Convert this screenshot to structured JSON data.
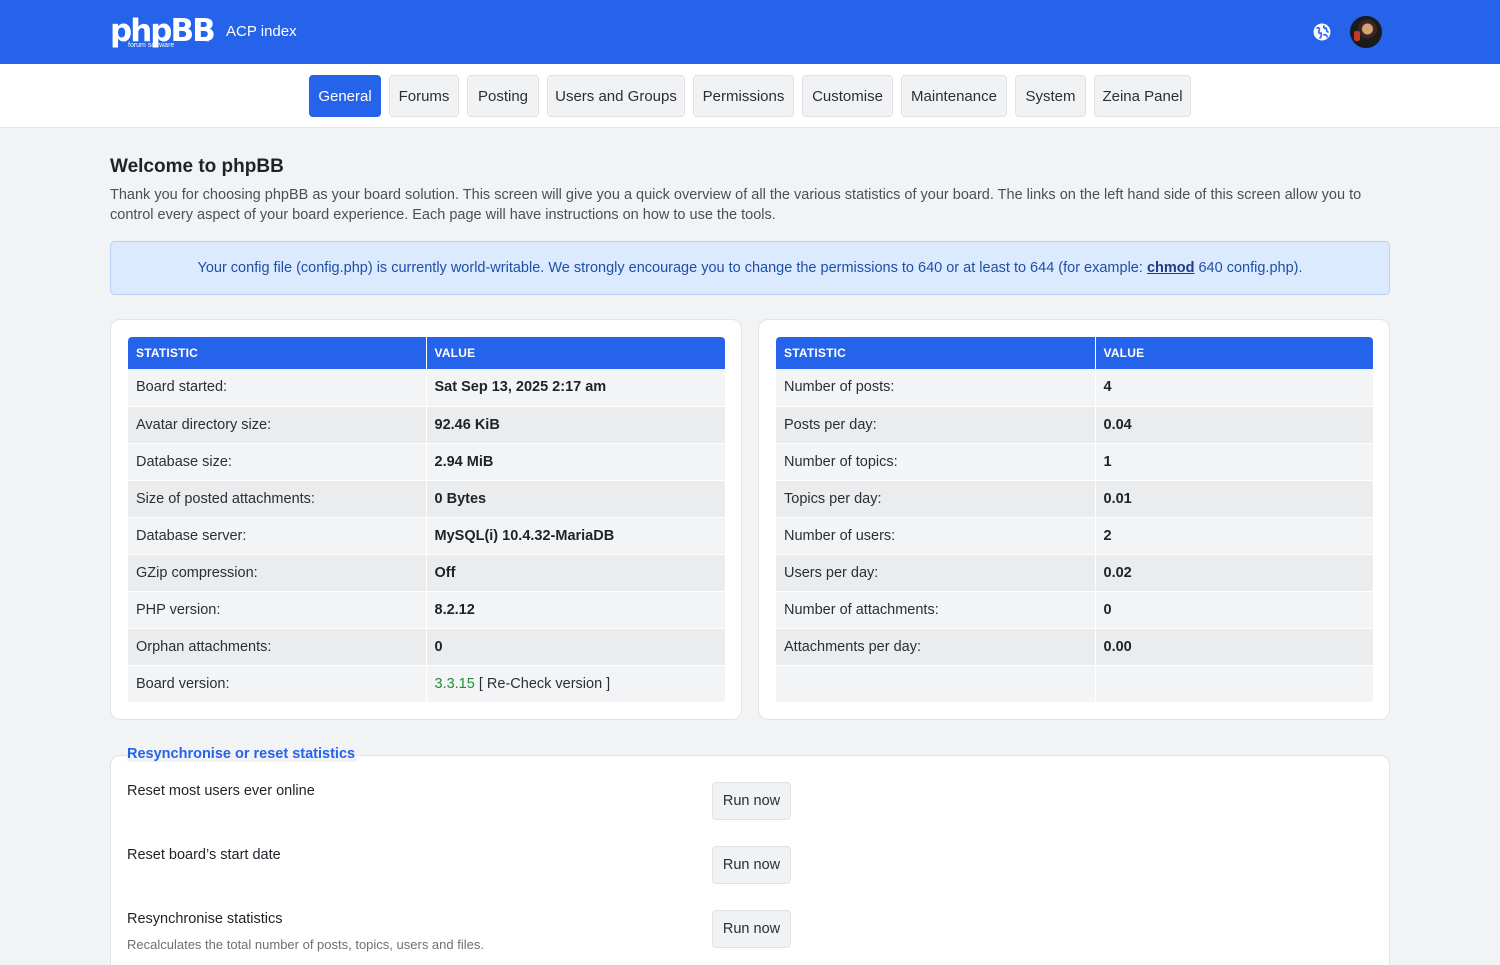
{
  "header": {
    "logo_text": "phpBB",
    "logo_sub": "forum  software",
    "logo_reg": "®",
    "title": "ACP index",
    "icons": [
      "globe-icon",
      "avatar"
    ]
  },
  "nav": {
    "tabs": [
      {
        "label": "General",
        "active": true
      },
      {
        "label": "Forums"
      },
      {
        "label": "Posting"
      },
      {
        "label": "Users and Groups"
      },
      {
        "label": "Permissions"
      },
      {
        "label": "Customise"
      },
      {
        "label": "Maintenance"
      },
      {
        "label": "System"
      },
      {
        "label": "Zeina Panel"
      }
    ]
  },
  "welcome": {
    "title": "Welcome to phpBB",
    "text": "Thank you for choosing phpBB as your board solution. This screen will give you a quick overview of all the various statistics of your board. The links on the left hand side of this screen allow you to control every aspect of your board experience. Each page will have instructions on how to use the tools."
  },
  "notice": {
    "before": "Your config file (config.php) is currently world-writable. We strongly encourage you to change the permissions to 640 or at least to 644 (for example: ",
    "link": "chmod",
    "after": " 640 config.php)."
  },
  "stats_left": {
    "headers": [
      "STATISTIC",
      "VALUE"
    ],
    "rows": [
      [
        "Board started:",
        "Sat Sep 13, 2025 2:17 am"
      ],
      [
        "Avatar directory size:",
        "92.46 KiB"
      ],
      [
        "Database size:",
        "2.94 MiB"
      ],
      [
        "Size of posted attachments:",
        "0 Bytes"
      ],
      [
        "Database server:",
        "MySQL(i) 10.4.32-MariaDB"
      ],
      [
        "GZip compression:",
        "Off"
      ],
      [
        "PHP version:",
        "8.2.12"
      ],
      [
        "Orphan attachments:",
        "0"
      ]
    ],
    "version_label": "Board version:",
    "version_number": "3.3.15",
    "version_recheck": " [ Re-Check version ]"
  },
  "stats_right": {
    "headers": [
      "STATISTIC",
      "VALUE"
    ],
    "rows": [
      [
        "Number of posts:",
        "4"
      ],
      [
        "Posts per day:",
        "0.04"
      ],
      [
        "Number of topics:",
        "1"
      ],
      [
        "Topics per day:",
        "0.01"
      ],
      [
        "Number of users:",
        "2"
      ],
      [
        "Users per day:",
        "0.02"
      ],
      [
        "Number of attachments:",
        "0"
      ],
      [
        "Attachments per day:",
        "0.00"
      ],
      [
        "",
        ""
      ]
    ]
  },
  "resync": {
    "legend": "Resynchronise or reset statistics",
    "items": [
      {
        "label": "Reset most users ever online",
        "button": "Run now"
      },
      {
        "label": "Reset board’s start date",
        "button": "Run now"
      },
      {
        "label": "Resynchronise statistics",
        "desc": "Recalculates the total number of posts, topics, users and files.",
        "button": "Run now"
      }
    ]
  },
  "colors": {
    "primary": "#2563eb",
    "notice_bg": "#dbeafe",
    "version_green": "#23903a"
  }
}
